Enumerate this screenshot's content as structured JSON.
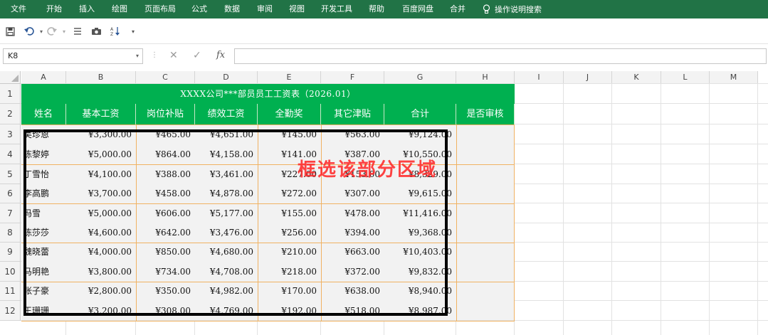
{
  "menu": [
    "文件",
    "开始",
    "插入",
    "绘图",
    "页面布局",
    "公式",
    "数据",
    "审阅",
    "视图",
    "开发工具",
    "帮助",
    "百度网盘",
    "合并"
  ],
  "tell_me": "操作说明搜索",
  "name_box": "K8",
  "formula": "",
  "icons": {
    "save": "save-icon",
    "undo": "undo-icon",
    "redo": "redo-icon",
    "form": "form-icon",
    "camera": "camera-icon",
    "sort": "sort-icon",
    "customize": "customize-qat-icon",
    "tell_me": "lightbulb-icon",
    "cancel": "cancel-icon",
    "enter": "enter-icon"
  },
  "fx_label": "fx",
  "columns": [
    "A",
    "B",
    "C",
    "D",
    "E",
    "F",
    "G",
    "H",
    "I",
    "J",
    "K",
    "L",
    "M"
  ],
  "rows": [
    "1",
    "2",
    "3",
    "4",
    "5",
    "6",
    "7",
    "8",
    "9",
    "10",
    "11",
    "12"
  ],
  "table": {
    "title": "XXXX公司***部员员工工资表（2026.01）",
    "headers": [
      "姓名",
      "基本工资",
      "岗位补贴",
      "绩效工资",
      "全勤奖",
      "其它津贴",
      "合计",
      "是否审核"
    ],
    "rows": [
      [
        "吴珍恩",
        "¥3,300.00",
        "¥465.00",
        "¥4,651.00",
        "¥145.00",
        "¥563.00",
        "¥9,124.00",
        ""
      ],
      [
        "陈黎婷",
        "¥5,000.00",
        "¥864.00",
        "¥4,158.00",
        "¥141.00",
        "¥387.00",
        "¥10,550.00",
        ""
      ],
      [
        "丁雪怡",
        "¥4,100.00",
        "¥388.00",
        "¥3,461.00",
        "¥227.00",
        "¥153.00",
        "¥8,329.00",
        ""
      ],
      [
        "李高鹏",
        "¥3,700.00",
        "¥458.00",
        "¥4,878.00",
        "¥272.00",
        "¥307.00",
        "¥9,615.00",
        ""
      ],
      [
        "冯雪",
        "¥5,000.00",
        "¥606.00",
        "¥5,177.00",
        "¥155.00",
        "¥478.00",
        "¥11,416.00",
        ""
      ],
      [
        "陈莎莎",
        "¥4,600.00",
        "¥642.00",
        "¥3,476.00",
        "¥256.00",
        "¥394.00",
        "¥9,368.00",
        ""
      ],
      [
        "魏晓蕾",
        "¥4,000.00",
        "¥850.00",
        "¥4,680.00",
        "¥210.00",
        "¥663.00",
        "¥10,403.00",
        ""
      ],
      [
        "马明艳",
        "¥3,800.00",
        "¥734.00",
        "¥4,708.00",
        "¥218.00",
        "¥372.00",
        "¥9,832.00",
        ""
      ],
      [
        "张子豪",
        "¥2,800.00",
        "¥350.00",
        "¥4,982.00",
        "¥170.00",
        "¥638.00",
        "¥8,940.00",
        ""
      ],
      [
        "王珊珊",
        "¥3,200.00",
        "¥308.00",
        "¥4,769.00",
        "¥192.00",
        "¥518.00",
        "¥8,987.00",
        ""
      ]
    ]
  },
  "overlay_text": "框选该部分区域",
  "colors": {
    "ribbon": "#217346",
    "header_fill": "#00b050",
    "cell_fill": "#f2f2f2",
    "border": "#f0b262",
    "annotation": "#ff2a2a",
    "selection": "#000000"
  }
}
